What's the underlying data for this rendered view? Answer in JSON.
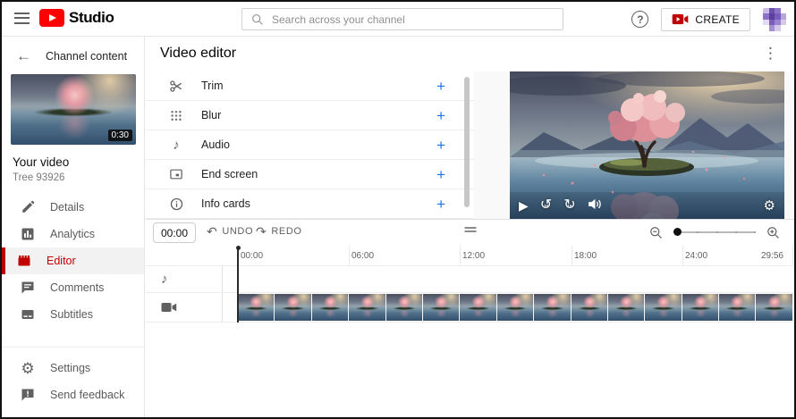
{
  "topbar": {
    "logo_text": "Studio",
    "search_placeholder": "Search across your channel",
    "help_symbol": "?",
    "create_label": "CREATE"
  },
  "sidebar": {
    "back_label": "Channel content",
    "video": {
      "title": "Your video",
      "subtitle": "Tree 93926",
      "duration": "0:30"
    },
    "items": [
      {
        "label": "Details",
        "icon": "pencil-icon",
        "selected": false
      },
      {
        "label": "Analytics",
        "icon": "analytics-icon",
        "selected": false
      },
      {
        "label": "Editor",
        "icon": "editor-icon",
        "selected": true
      },
      {
        "label": "Comments",
        "icon": "comments-icon",
        "selected": false
      },
      {
        "label": "Subtitles",
        "icon": "subtitles-icon",
        "selected": false
      }
    ],
    "footer_items": [
      {
        "label": "Settings",
        "icon": "gear-icon"
      },
      {
        "label": "Send feedback",
        "icon": "feedback-icon"
      }
    ]
  },
  "editor": {
    "title": "Video editor",
    "tools": [
      {
        "label": "Trim",
        "icon": "scissors-icon"
      },
      {
        "label": "Blur",
        "icon": "blur-icon"
      },
      {
        "label": "Audio",
        "icon": "music-note-icon"
      },
      {
        "label": "End screen",
        "icon": "end-screen-icon"
      },
      {
        "label": "Info cards",
        "icon": "info-icon"
      }
    ],
    "add_symbol": "+"
  },
  "timeline": {
    "current_time": "00:00",
    "undo_label": "UNDO",
    "redo_label": "REDO",
    "ruler_ticks": [
      "00:00",
      "06:00",
      "12:00",
      "18:00",
      "24:00",
      "29:56"
    ],
    "tracks": [
      {
        "type": "audio",
        "icon": "music-note-icon"
      },
      {
        "type": "video",
        "icon": "video-camera-icon"
      }
    ],
    "filmstrip_thumbnail_count": 15
  },
  "colors": {
    "accent_red": "#c00000",
    "accent_blue": "#1a73e8",
    "text_secondary": "#606060",
    "background": "#f9f9f9"
  }
}
